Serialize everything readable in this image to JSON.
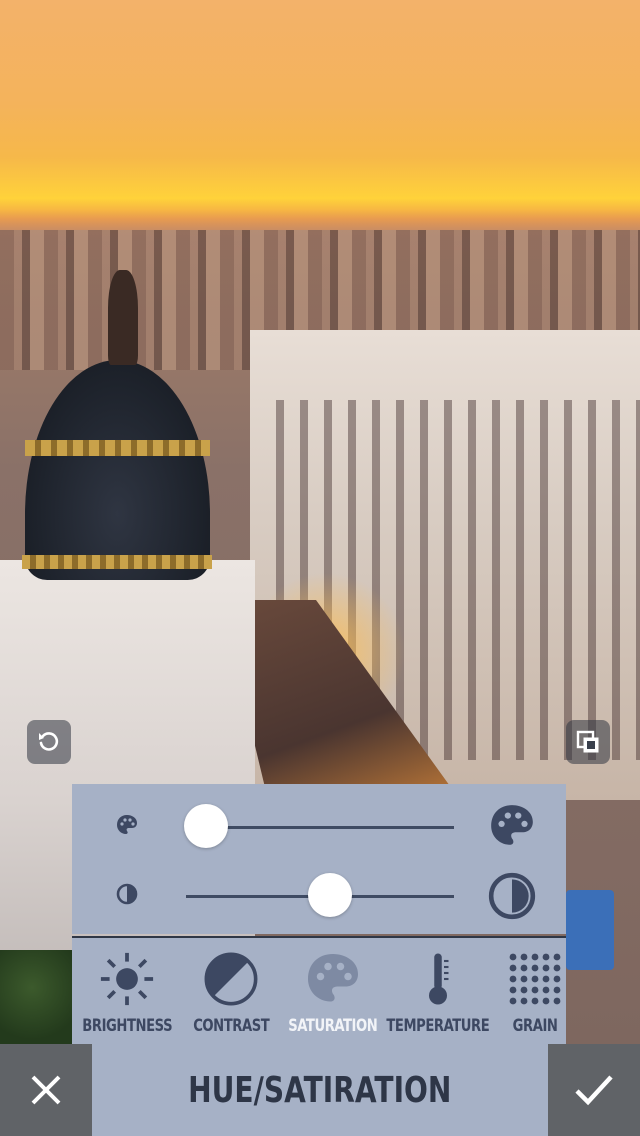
{
  "photo": {
    "subject": "city-skyline-sunset"
  },
  "overlay": {
    "rotate_icon": "rotate-ccw-icon",
    "compare_icon": "compare-layers-icon"
  },
  "sliders": [
    {
      "small_icon": "palette-small-icon",
      "large_icon": "palette-large-icon",
      "value": 0.0
    },
    {
      "small_icon": "contrast-small-icon",
      "large_icon": "contrast-large-icon",
      "value": 0.5
    }
  ],
  "tools": [
    {
      "label": "BRIGHTNESS",
      "icon": "sun-icon",
      "active": false
    },
    {
      "label": "CONTRAST",
      "icon": "contrast-icon",
      "active": false
    },
    {
      "label": "SATURATION",
      "icon": "palette-icon",
      "active": true
    },
    {
      "label": "TEMPERATURE",
      "icon": "thermometer-icon",
      "active": false
    },
    {
      "label": "GRAIN",
      "icon": "grain-icon",
      "active": false
    }
  ],
  "bottom_bar": {
    "title": "HUE/SATIRATION",
    "cancel_icon": "close-icon",
    "confirm_icon": "check-icon"
  },
  "colors": {
    "panel_bg": "#a6b1c6",
    "icon_dark": "#3d4862",
    "bottom_button_bg": "#606367"
  }
}
